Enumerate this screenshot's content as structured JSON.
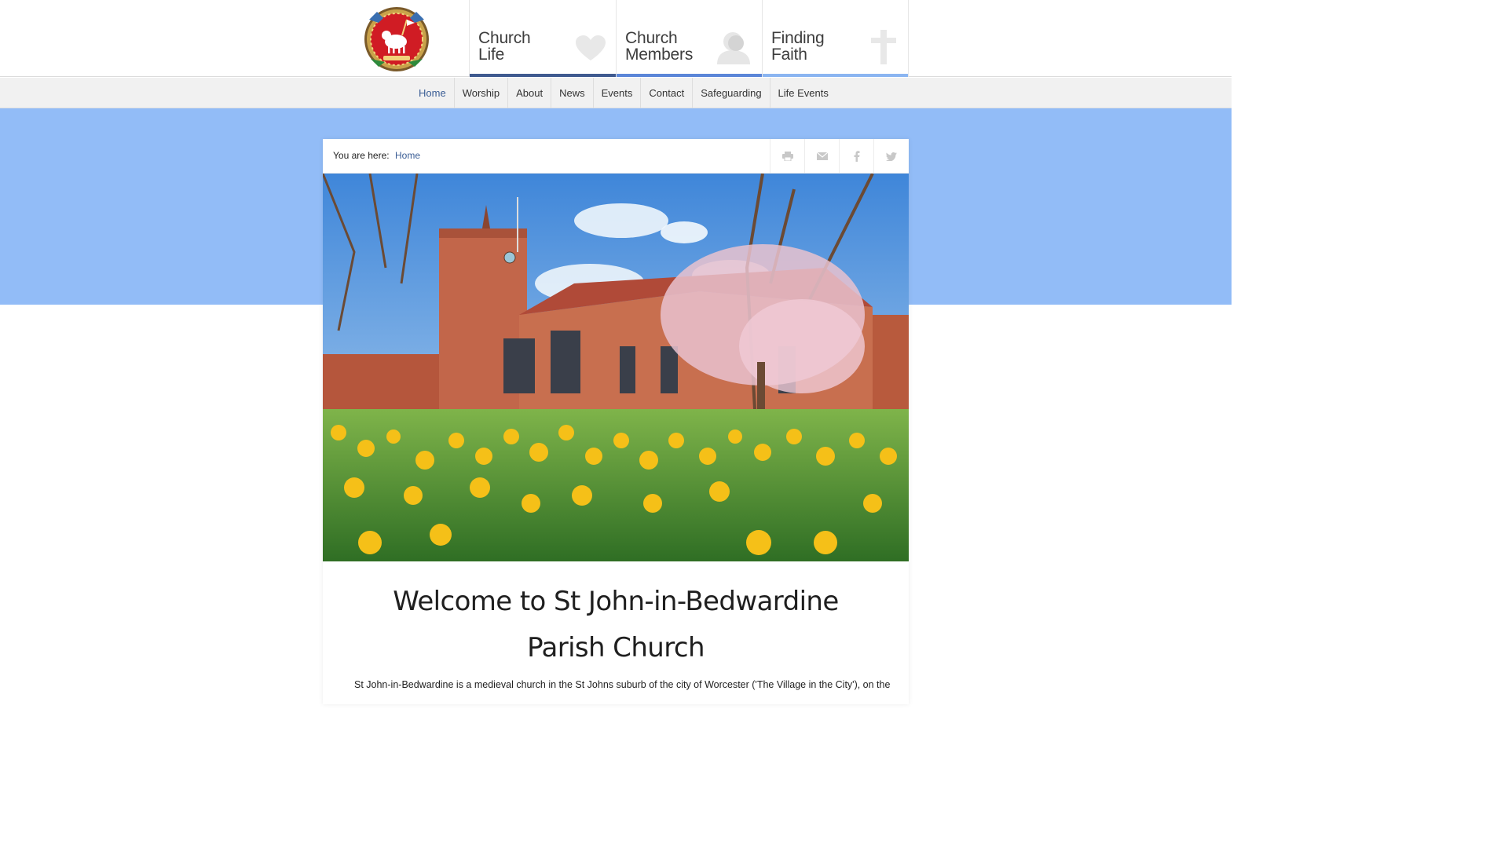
{
  "header": {
    "logo_icon": "lamb-crest-icon",
    "features": [
      {
        "line1": "Church",
        "line2": "Life",
        "icon": "heart-icon",
        "bar_color": "#3f5a8f"
      },
      {
        "line1": "Church",
        "line2": "Members",
        "icon": "person-icon",
        "bar_color": "#5b86d8"
      },
      {
        "line1": "Finding",
        "line2": "Faith",
        "icon": "cross-icon",
        "bar_color": "#8bb5f1"
      }
    ]
  },
  "nav": {
    "items": [
      "Home",
      "Worship",
      "About",
      "News",
      "Events",
      "Contact",
      "Safeguarding",
      "Life Events"
    ],
    "active": "Home"
  },
  "breadcrumb": {
    "label": "You are here:",
    "current": "Home"
  },
  "share": {
    "icons": [
      "print-icon",
      "email-icon",
      "facebook-icon",
      "twitter-icon"
    ]
  },
  "main": {
    "title_line1": "Welcome to St John-in-Bedwardine",
    "title_line2": "Parish Church",
    "intro": "St John-in-Bedwardine is a medieval church in the St Johns suburb of the city of Worcester ('The Village in the City'), on the"
  },
  "colors": {
    "band": "#92bcf7",
    "link": "#3a5d95"
  }
}
